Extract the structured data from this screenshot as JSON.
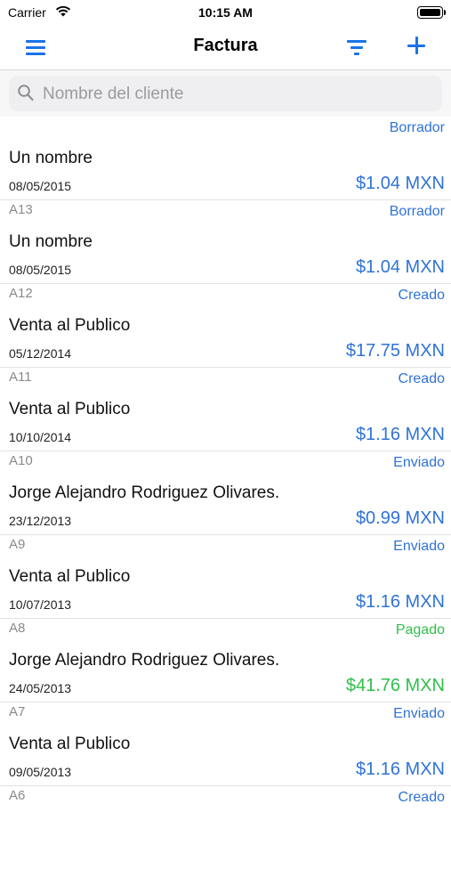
{
  "status_bar": {
    "carrier": "Carrier",
    "time": "10:15 AM"
  },
  "nav": {
    "title": "Factura"
  },
  "search": {
    "placeholder": "Nombre del cliente"
  },
  "colors": {
    "accent": "#2f73d6",
    "paid": "#2fbf4a"
  },
  "invoices": [
    {
      "folio": "",
      "status": "Borrador",
      "status_color": "blue",
      "name": "Un nombre",
      "date": "08/05/2015",
      "amount": "$1.04 MXN"
    },
    {
      "folio": "A13",
      "status": "Borrador",
      "status_color": "blue",
      "name": "Un nombre",
      "date": "08/05/2015",
      "amount": "$1.04 MXN"
    },
    {
      "folio": "A12",
      "status": "Creado",
      "status_color": "blue",
      "name": "Venta al Publico",
      "date": "05/12/2014",
      "amount": "$17.75 MXN"
    },
    {
      "folio": "A11",
      "status": "Creado",
      "status_color": "blue",
      "name": "Venta al Publico",
      "date": "10/10/2014",
      "amount": "$1.16 MXN"
    },
    {
      "folio": "A10",
      "status": "Enviado",
      "status_color": "blue",
      "name": "Jorge Alejandro Rodriguez Olivares.",
      "date": "23/12/2013",
      "amount": "$0.99 MXN"
    },
    {
      "folio": "A9",
      "status": "Enviado",
      "status_color": "blue",
      "name": "Venta al Publico",
      "date": "10/07/2013",
      "amount": "$1.16 MXN"
    },
    {
      "folio": "A8",
      "status": "Pagado",
      "status_color": "green",
      "name": "Jorge Alejandro Rodriguez Olivares.",
      "date": "24/05/2013",
      "amount": "$41.76 MXN"
    },
    {
      "folio": "A7",
      "status": "Enviado",
      "status_color": "blue",
      "name": "Venta al Publico",
      "date": "09/05/2013",
      "amount": "$1.16 MXN"
    },
    {
      "folio": "A6",
      "status": "Creado",
      "status_color": "blue",
      "name": "",
      "date": "",
      "amount": ""
    }
  ]
}
